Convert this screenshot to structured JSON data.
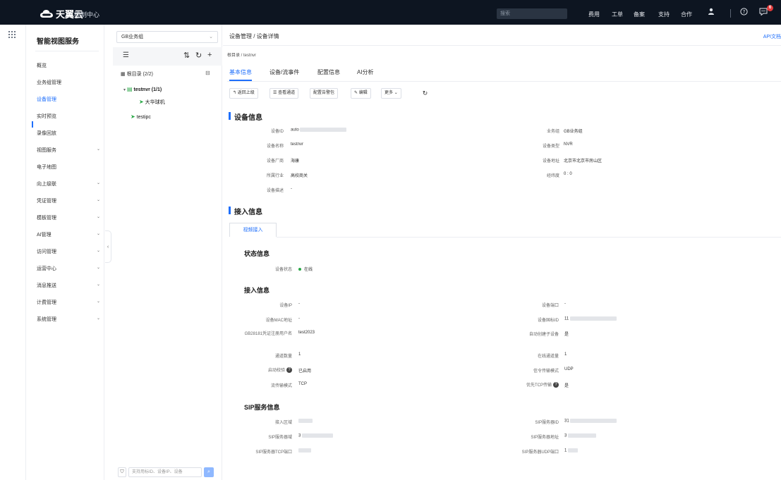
{
  "topbar": {
    "brand": "天翼云",
    "console": "控制中心",
    "search_placeholder": "搜索",
    "nav": [
      "费用",
      "工单",
      "备案",
      "支持",
      "合作"
    ],
    "notification_count": "6"
  },
  "menu": {
    "title": "智能视图服务",
    "items": [
      {
        "label": "概览",
        "has_children": false
      },
      {
        "label": "业务组管理",
        "has_children": false
      },
      {
        "label": "设备管理",
        "has_children": false,
        "active": true
      },
      {
        "label": "实时预览",
        "has_children": false
      },
      {
        "label": "录像回放",
        "has_children": false
      },
      {
        "label": "视图服务",
        "has_children": true
      },
      {
        "label": "电子地图",
        "has_children": false
      },
      {
        "label": "向上级联",
        "has_children": true
      },
      {
        "label": "凭证管理",
        "has_children": true
      },
      {
        "label": "模板管理",
        "has_children": true
      },
      {
        "label": "AI管理",
        "has_children": true
      },
      {
        "label": "访问管理",
        "has_children": true
      },
      {
        "label": "运营中心",
        "has_children": true
      },
      {
        "label": "消息推送",
        "has_children": true
      },
      {
        "label": "计费管理",
        "has_children": true
      },
      {
        "label": "系统管理",
        "has_children": true
      }
    ]
  },
  "tree": {
    "group_select": "GB业务组",
    "root_label": "根目录 (2/2)",
    "nodes": [
      {
        "label": "testnvr (1/1)"
      },
      {
        "label": "大华球机"
      },
      {
        "label": "testipc"
      }
    ],
    "search_placeholder": "支持用标ID、设备IP、设备"
  },
  "main": {
    "breadcrumb": "设备管理 / 设备详情",
    "api_doc": "API文档",
    "sub_breadcrumb": "根目录 / testnvr",
    "tabs": [
      "基本信息",
      "设备/流事件",
      "配置信息",
      "AI分析"
    ],
    "actions": [
      "返回上级",
      "查看通道",
      "配置告警包",
      "编辑",
      "更多"
    ],
    "device_info": {
      "title": "设备信息",
      "left": [
        {
          "label": "设备ID",
          "value": "auto"
        },
        {
          "label": "设备名称",
          "value": "testnvr"
        },
        {
          "label": "设备厂商",
          "value": "海康"
        },
        {
          "label": "所属行业",
          "value": "高校商关"
        },
        {
          "label": "设备描述",
          "value": "-"
        }
      ],
      "right": [
        {
          "label": "业务组",
          "value": "GB业务组"
        },
        {
          "label": "设备类型",
          "value": "NVR"
        },
        {
          "label": "设备地址",
          "value": "北京市北京市房山区"
        },
        {
          "label": "经纬度",
          "value": "0 : 0"
        }
      ]
    },
    "access_info": {
      "title": "接入信息",
      "subtab": "视频接入",
      "status": {
        "title": "状态信息",
        "label": "设备状态",
        "value": "在线"
      },
      "access": {
        "title": "接入信息",
        "left": [
          {
            "label": "设备IP",
            "value": "-"
          },
          {
            "label": "设备MAC地址",
            "value": "-"
          },
          {
            "label": "GB28181凭证注册用户名",
            "value": "test2023"
          },
          {
            "label": "通道数量",
            "value": "1"
          },
          {
            "label": "启动校验",
            "value": "已启用"
          },
          {
            "label": "流传输模式",
            "value": "TCP"
          }
        ],
        "right": [
          {
            "label": "设备端口",
            "value": "-"
          },
          {
            "label": "设备国标ID",
            "value": "11"
          },
          {
            "label": "自动创建子设备",
            "value": "是"
          },
          {
            "label": "在线通道量",
            "value": "1"
          },
          {
            "label": "信令传输模式",
            "value": "UDP"
          },
          {
            "label": "优先TCP传输",
            "value": "是"
          }
        ]
      },
      "sip": {
        "title": "SIP服务信息",
        "left": [
          {
            "label": "接入区域",
            "value": ""
          },
          {
            "label": "SIP服务器域",
            "value": "3"
          },
          {
            "label": "SIP服务器TCP端口",
            "value": ""
          }
        ],
        "right": [
          {
            "label": "SIP服务器ID",
            "value": "31"
          },
          {
            "label": "SIP服务器地址",
            "value": "3"
          },
          {
            "label": "SIP服务器UDP端口",
            "value": "1"
          }
        ]
      }
    }
  }
}
